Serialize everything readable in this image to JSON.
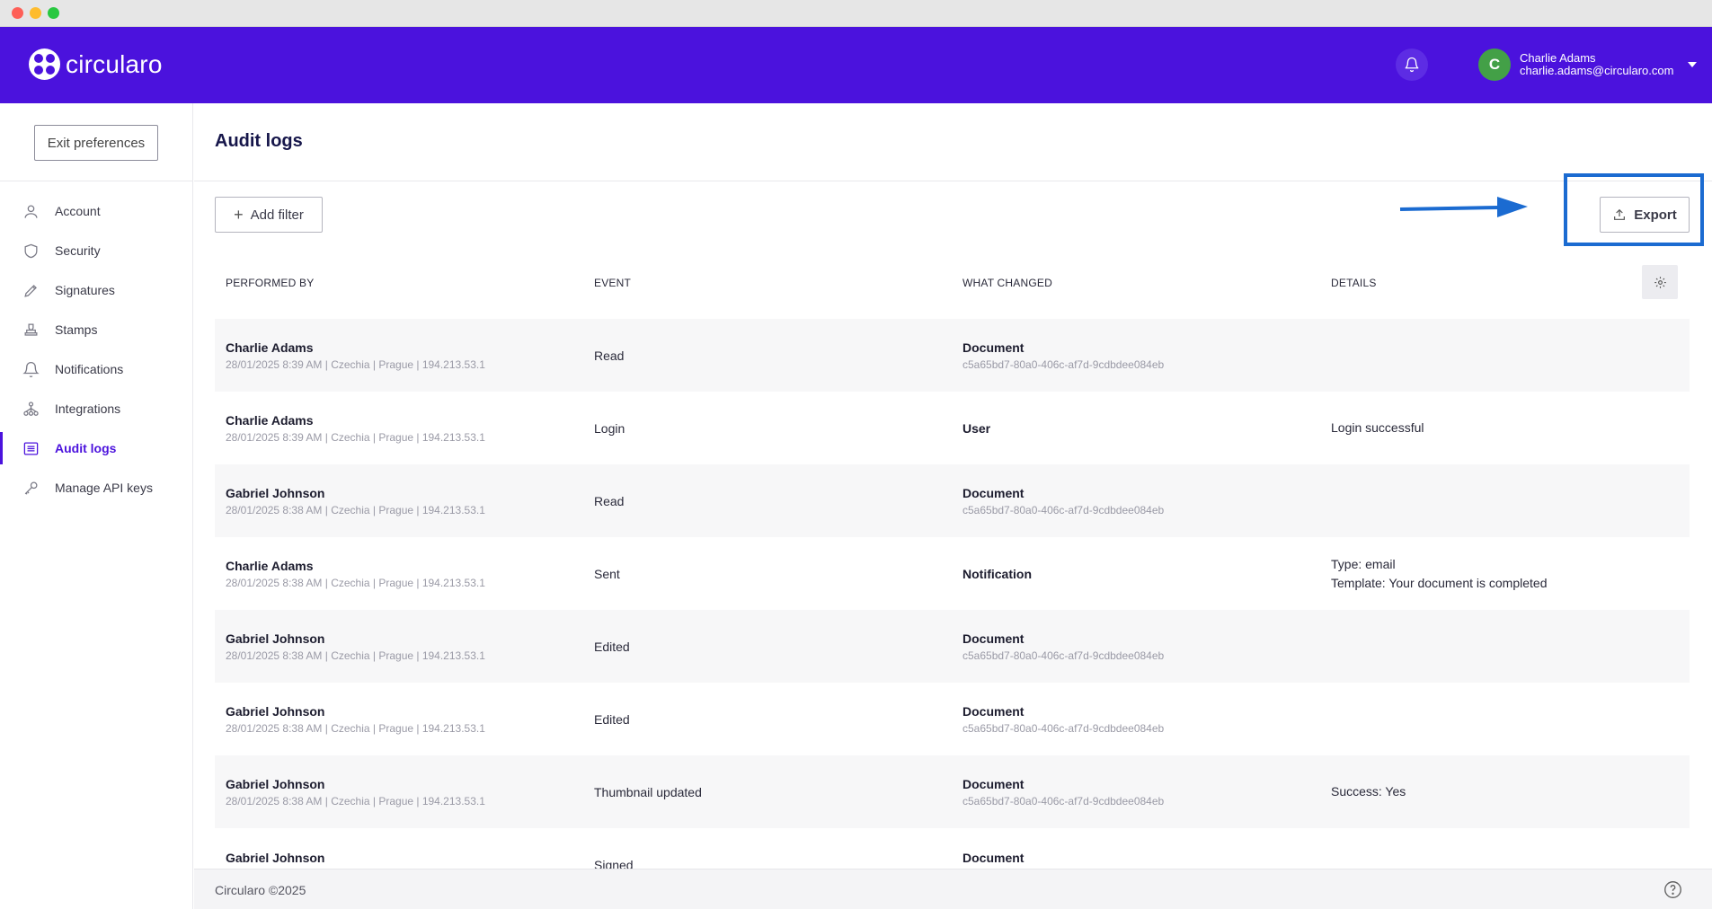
{
  "app": {
    "logo_text": "circularo",
    "user_name": "Charlie Adams",
    "user_email": "charlie.adams@circularo.com",
    "avatar_initial": "C"
  },
  "sidebar": {
    "exit_label": "Exit preferences",
    "items": [
      {
        "label": "Account",
        "icon": "user-icon"
      },
      {
        "label": "Security",
        "icon": "shield-icon"
      },
      {
        "label": "Signatures",
        "icon": "pen-icon"
      },
      {
        "label": "Stamps",
        "icon": "stamp-icon"
      },
      {
        "label": "Notifications",
        "icon": "bell-icon"
      },
      {
        "label": "Integrations",
        "icon": "integrations-icon"
      },
      {
        "label": "Audit logs",
        "icon": "list-icon",
        "active": true
      },
      {
        "label": "Manage API keys",
        "icon": "key-icon"
      }
    ]
  },
  "main": {
    "title": "Audit logs",
    "add_filter_label": "Add filter",
    "export_label": "Export"
  },
  "table": {
    "columns": [
      "PERFORMED BY",
      "EVENT",
      "WHAT CHANGED",
      "DETAILS"
    ],
    "rows": [
      {
        "name": "Charlie Adams",
        "meta": "28/01/2025 8:39 AM  |  Czechia  |  Prague  |  194.213.53.1",
        "event": "Read",
        "what": "Document",
        "uuid": "c5a65bd7-80a0-406c-af7d-9cdbdee084eb",
        "details": [
          "",
          ""
        ]
      },
      {
        "name": "Charlie Adams",
        "meta": "28/01/2025 8:39 AM  |  Czechia  |  Prague  |  194.213.53.1",
        "event": "Login",
        "what": "User",
        "uuid": "",
        "details": [
          "Login successful",
          ""
        ]
      },
      {
        "name": "Gabriel Johnson",
        "meta": "28/01/2025 8:38 AM  |  Czechia  |  Prague  |  194.213.53.1",
        "event": "Read",
        "what": "Document",
        "uuid": "c5a65bd7-80a0-406c-af7d-9cdbdee084eb",
        "details": [
          "",
          ""
        ]
      },
      {
        "name": "Charlie Adams",
        "meta": "28/01/2025 8:38 AM  |  Czechia  |  Prague  |  194.213.53.1",
        "event": "Sent",
        "what": "Notification",
        "uuid": "",
        "details": [
          "Type: email",
          "Template: Your document is completed"
        ]
      },
      {
        "name": "Gabriel Johnson",
        "meta": "28/01/2025 8:38 AM  |  Czechia  |  Prague  |  194.213.53.1",
        "event": "Edited",
        "what": "Document",
        "uuid": "c5a65bd7-80a0-406c-af7d-9cdbdee084eb",
        "details": [
          "",
          ""
        ]
      },
      {
        "name": "Gabriel Johnson",
        "meta": "28/01/2025 8:38 AM  |  Czechia  |  Prague  |  194.213.53.1",
        "event": "Edited",
        "what": "Document",
        "uuid": "c5a65bd7-80a0-406c-af7d-9cdbdee084eb",
        "details": [
          "",
          ""
        ]
      },
      {
        "name": "Gabriel Johnson",
        "meta": "28/01/2025 8:38 AM  |  Czechia  |  Prague  |  194.213.53.1",
        "event": "Thumbnail updated",
        "what": "Document",
        "uuid": "c5a65bd7-80a0-406c-af7d-9cdbdee084eb",
        "details": [
          "Success: Yes",
          ""
        ]
      },
      {
        "name": "Gabriel Johnson",
        "meta": "",
        "event": "Signed",
        "what": "Document",
        "uuid": "",
        "details": [
          "",
          ""
        ]
      }
    ]
  },
  "footer": {
    "copyright": "Circularo ©2025"
  },
  "colors": {
    "brand": "#4b12dd",
    "highlight": "#1b6bd1",
    "avatar": "#43a047"
  }
}
